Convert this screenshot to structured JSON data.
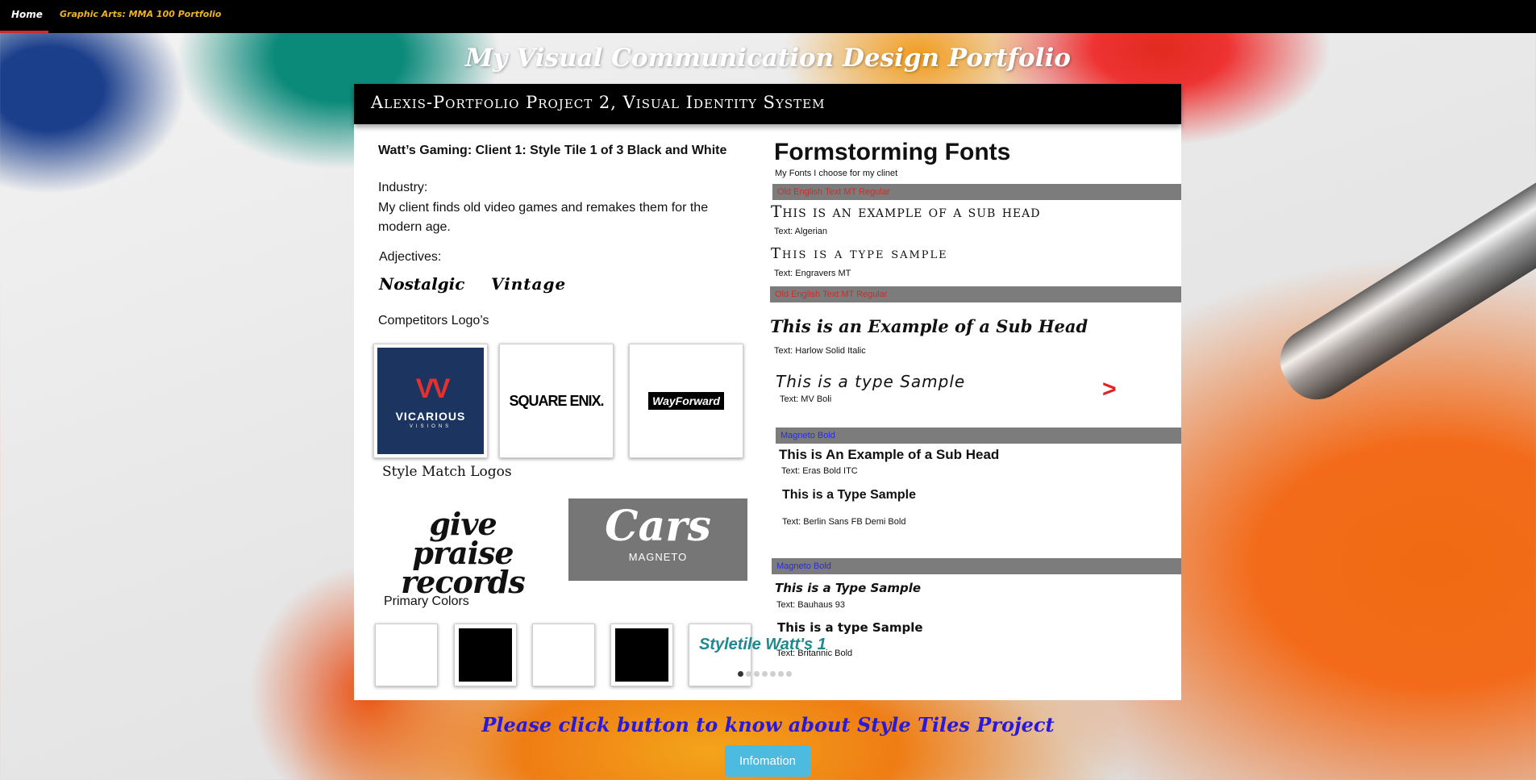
{
  "nav": {
    "home": "Home",
    "portfolio": "Graphic Arts: MMA 100 Portfolio"
  },
  "site_title": "My Visual Communication Design Portfolio",
  "panel": {
    "header": "Alexis-Portfolio Project 2, Visual Identity System",
    "left": {
      "title": "Watt’s Gaming: Client 1: Style Tile 1 of 3 Black and White",
      "industry_label": "Industry:",
      "industry_text": "My client finds old video games and remakes them for the modern age.",
      "adjectives_label": "Adjectives:",
      "adjectives": [
        "Nostalgic",
        "Vintage"
      ],
      "competitors_label": "Competitors Logo’s",
      "competitors": {
        "vicarious_name": "VICARIOUS",
        "vicarious_sub": "VISIONS",
        "square_enix": "SQUARE ENIX.",
        "wayforward": "WayForward"
      },
      "style_match_label": "Style Match Logos",
      "give_praise": "give praise records",
      "cars_word": "Cars",
      "cars_sub": "MAGNETO",
      "primary_colors_label": "Primary Colors",
      "primary_colors": [
        "#ffffff",
        "#000000",
        "#ffffff",
        "#000000",
        "#ffffff"
      ],
      "styletile_overlay": "Styletile Watt's 1",
      "slides_total": 7,
      "slide_active": 1
    },
    "right": {
      "title": "Formstorming Fonts",
      "subtitle": "My Fonts I choose for my clinet",
      "bar1": "Old English Text MT Regular",
      "sample1": "This is an example of a sub head",
      "cap1": "Text: Algerian",
      "sample2": "This is a type sample",
      "cap2": "Text: Engravers MT",
      "bar2": "Old English Text MT Regular",
      "sample3": "This is an Example of a Sub Head",
      "cap3": "Text: Harlow Solid Italic",
      "sample4": "This is a type Sample",
      "cap4": "Text: MV Boli",
      "arrow": ">",
      "bar3": "Magneto Bold",
      "sample5": "This is An Example of a Sub Head",
      "cap5": "Text: Eras Bold ITC",
      "sample6": "This is a Type Sample",
      "cap6": "Text: Berlin Sans FB Demi Bold",
      "bar4": "Magneto Bold",
      "sample7": "This is a Type Sample",
      "cap7": "Text: Bauhaus 93",
      "sample8": "This is a type Sample",
      "cap8": "Text: Britannic Bold"
    }
  },
  "footer": {
    "prompt": "Please click button to know about Style Tiles Project",
    "button": "Infomation"
  },
  "colors": {
    "bar_red_text": "#c9302c",
    "bar_blue_text": "#2a2ae0",
    "button": "#4dbbe0",
    "footer_text": "#2a1ad8"
  }
}
